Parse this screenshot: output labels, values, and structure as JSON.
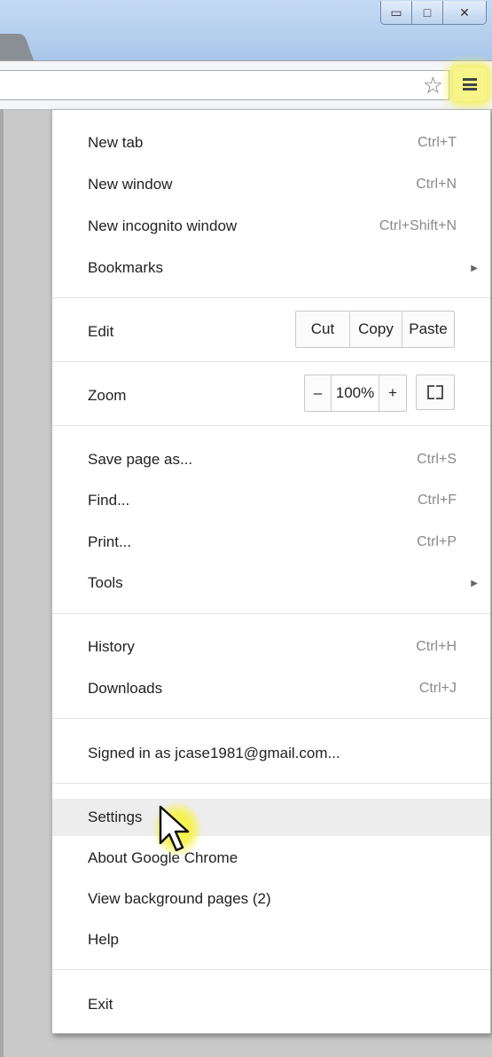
{
  "window": {
    "minimize_glyph": "▭",
    "maximize_glyph": "□",
    "close_glyph": "✕"
  },
  "toolbar": {
    "bookmark_icon": "star-icon",
    "menu_icon": "hamburger-menu-icon"
  },
  "menu": {
    "new_tab": {
      "label": "New tab",
      "shortcut": "Ctrl+T"
    },
    "new_window": {
      "label": "New window",
      "shortcut": "Ctrl+N"
    },
    "new_incognito": {
      "label": "New incognito window",
      "shortcut": "Ctrl+Shift+N"
    },
    "bookmarks": {
      "label": "Bookmarks"
    },
    "edit": {
      "label": "Edit",
      "cut": "Cut",
      "copy": "Copy",
      "paste": "Paste"
    },
    "zoom": {
      "label": "Zoom",
      "minus": "–",
      "level": "100%",
      "plus": "+"
    },
    "save_page": {
      "label": "Save page as...",
      "shortcut": "Ctrl+S"
    },
    "find": {
      "label": "Find...",
      "shortcut": "Ctrl+F"
    },
    "print": {
      "label": "Print...",
      "shortcut": "Ctrl+P"
    },
    "tools": {
      "label": "Tools"
    },
    "history": {
      "label": "History",
      "shortcut": "Ctrl+H"
    },
    "downloads": {
      "label": "Downloads",
      "shortcut": "Ctrl+J"
    },
    "signed_in": {
      "label": "Signed in as jcase1981@gmail.com..."
    },
    "settings": {
      "label": "Settings"
    },
    "about": {
      "label": "About Google Chrome"
    },
    "background_pages": {
      "label": "View background pages (2)"
    },
    "help": {
      "label": "Help"
    },
    "exit": {
      "label": "Exit"
    }
  },
  "colors": {
    "highlight": "#f3ef55",
    "hover_row": "#ededed"
  }
}
